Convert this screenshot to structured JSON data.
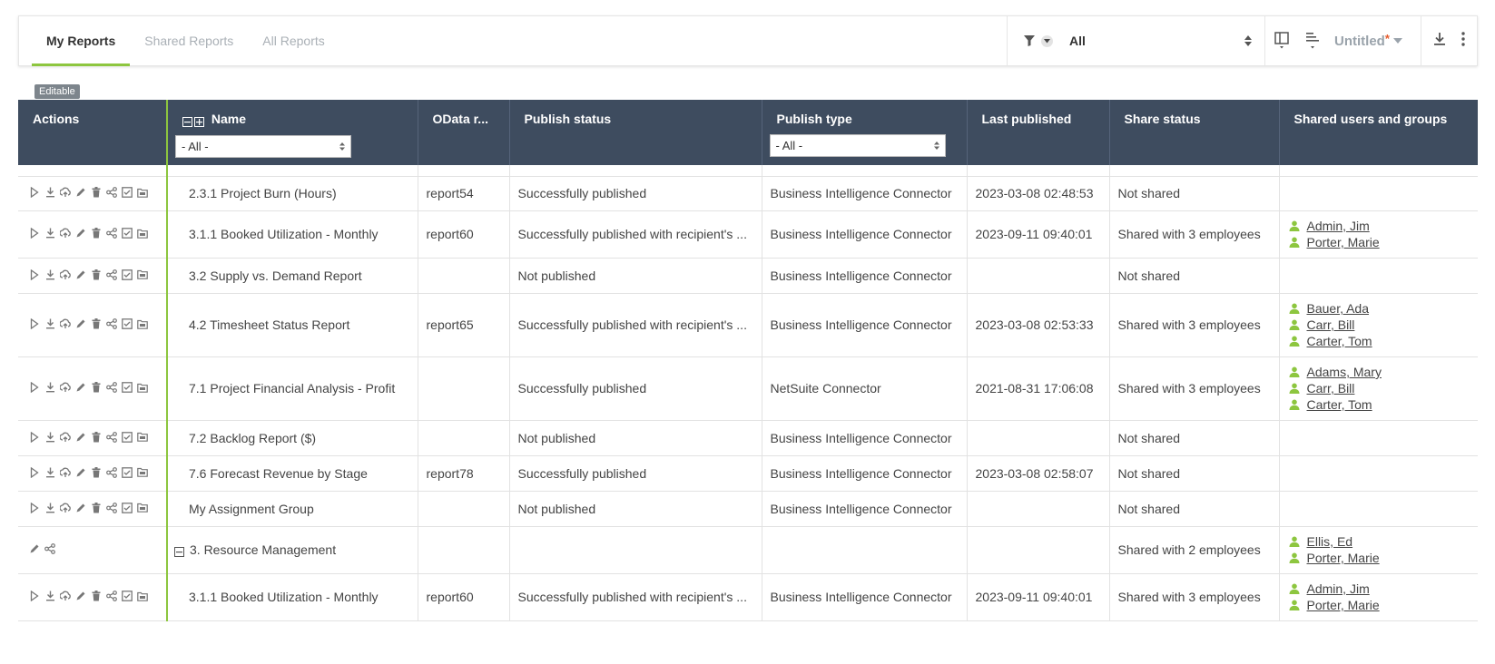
{
  "tabs": [
    {
      "label": "My Reports",
      "active": true
    },
    {
      "label": "Shared Reports",
      "active": false
    },
    {
      "label": "All Reports",
      "active": false
    }
  ],
  "filter": {
    "selected": "All"
  },
  "view": {
    "name": "Untitled",
    "modified_marker": "*"
  },
  "badge": "Editable",
  "columns": {
    "actions": "Actions",
    "name": "Name",
    "odata": "OData r...",
    "publish_status": "Publish status",
    "publish_type": "Publish type",
    "last_published": "Last published",
    "share_status": "Share status",
    "shared_users": "Shared users and groups"
  },
  "header_filters": {
    "name": "- All -",
    "publish_type": "- All -"
  },
  "colors": {
    "accent": "#8dc63f",
    "header_bg": "#3e4c5f",
    "user_icon": "#8dc63f",
    "star": "#e55a2b"
  },
  "rows": [
    {
      "kind": "report",
      "name": "2.3.1 Project Burn (Hours)",
      "odata": "report54",
      "publish_status": "Successfully published",
      "publish_type": "Business Intelligence Connector",
      "last_published": "2023-03-08 02:48:53",
      "share_status": "Not shared",
      "users": []
    },
    {
      "kind": "report",
      "name": "3.1.1 Booked Utilization - Monthly",
      "odata": "report60",
      "publish_status": "Successfully published with recipient's ...",
      "publish_type": "Business Intelligence Connector",
      "last_published": "2023-09-11 09:40:01",
      "share_status": "Shared with 3 employees",
      "users": [
        "Admin, Jim",
        "Porter, Marie"
      ]
    },
    {
      "kind": "report",
      "name": "3.2 Supply vs. Demand Report",
      "odata": "",
      "publish_status": "Not published",
      "publish_type": "Business Intelligence Connector",
      "last_published": "",
      "share_status": "Not shared",
      "users": []
    },
    {
      "kind": "report",
      "name": "4.2 Timesheet Status Report",
      "odata": "report65",
      "publish_status": "Successfully published with recipient's ...",
      "publish_type": "Business Intelligence Connector",
      "last_published": "2023-03-08 02:53:33",
      "share_status": "Shared with 3 employees",
      "users": [
        "Bauer, Ada",
        "Carr, Bill",
        "Carter, Tom"
      ]
    },
    {
      "kind": "report",
      "name": "7.1 Project Financial Analysis - Profit",
      "odata": "",
      "publish_status": "Successfully published",
      "publish_type": "NetSuite Connector",
      "last_published": "2021-08-31 17:06:08",
      "share_status": "Shared with 3 employees",
      "users": [
        "Adams, Mary",
        "Carr, Bill",
        "Carter, Tom"
      ]
    },
    {
      "kind": "report",
      "name": "7.2 Backlog Report ($)",
      "odata": "",
      "publish_status": "Not published",
      "publish_type": "Business Intelligence Connector",
      "last_published": "",
      "share_status": "Not shared",
      "users": []
    },
    {
      "kind": "report",
      "name": "7.6 Forecast Revenue by Stage",
      "odata": "report78",
      "publish_status": "Successfully published",
      "publish_type": "Business Intelligence Connector",
      "last_published": "2023-03-08 02:58:07",
      "share_status": "Not shared",
      "users": []
    },
    {
      "kind": "report",
      "name": "My Assignment Group",
      "odata": "",
      "publish_status": "Not published",
      "publish_type": "Business Intelligence Connector",
      "last_published": "",
      "share_status": "Not shared",
      "users": []
    },
    {
      "kind": "group",
      "name": "3. Resource Management",
      "odata": "",
      "publish_status": "",
      "publish_type": "",
      "last_published": "",
      "share_status": "Shared with 2 employees",
      "users": [
        "Ellis, Ed",
        "Porter, Marie"
      ]
    },
    {
      "kind": "report",
      "name": "3.1.1 Booked Utilization - Monthly",
      "odata": "report60",
      "publish_status": "Successfully published with recipient's ...",
      "publish_type": "Business Intelligence Connector",
      "last_published": "2023-09-11 09:40:01",
      "share_status": "Shared with 3 employees",
      "users": [
        "Admin, Jim",
        "Porter, Marie"
      ]
    }
  ]
}
